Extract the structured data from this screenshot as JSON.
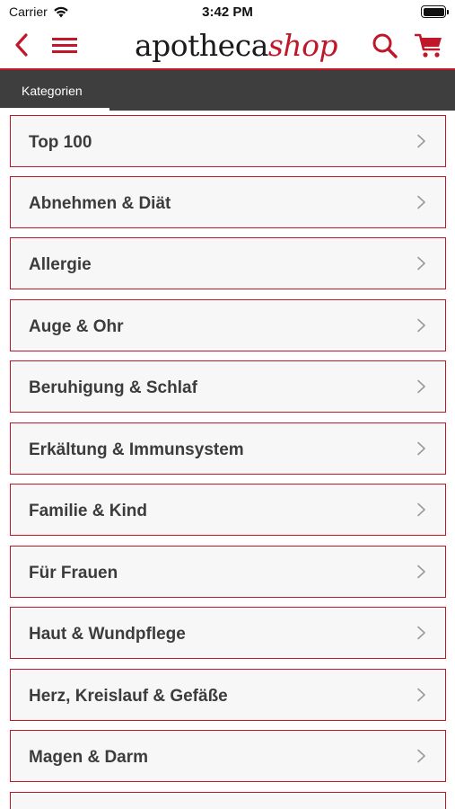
{
  "status_bar": {
    "carrier": "Carrier",
    "time": "3:42 PM"
  },
  "nav": {
    "back_icon": "chevron-left-icon",
    "menu_icon": "hamburger-menu-icon",
    "logo_part1": "apotheca",
    "logo_part2": "shop",
    "search_icon": "search-icon",
    "cart_icon": "cart-icon"
  },
  "tabs": {
    "active": "Kategorien"
  },
  "categories": [
    "Top 100",
    "Abnehmen & Diät",
    "Allergie",
    "Auge & Ohr",
    "Beruhigung & Schlaf",
    "Erkältung & Immunsystem",
    "Familie & Kind",
    "Für Frauen",
    "Haut & Wundpflege",
    "Herz, Kreislauf & Gefäße",
    "Magen & Darm",
    ""
  ],
  "colors": {
    "accent": "#c0182b",
    "tab_bar": "#3e3e3e",
    "item_bg": "#f7f7f7",
    "item_text": "#3c3c3c"
  }
}
